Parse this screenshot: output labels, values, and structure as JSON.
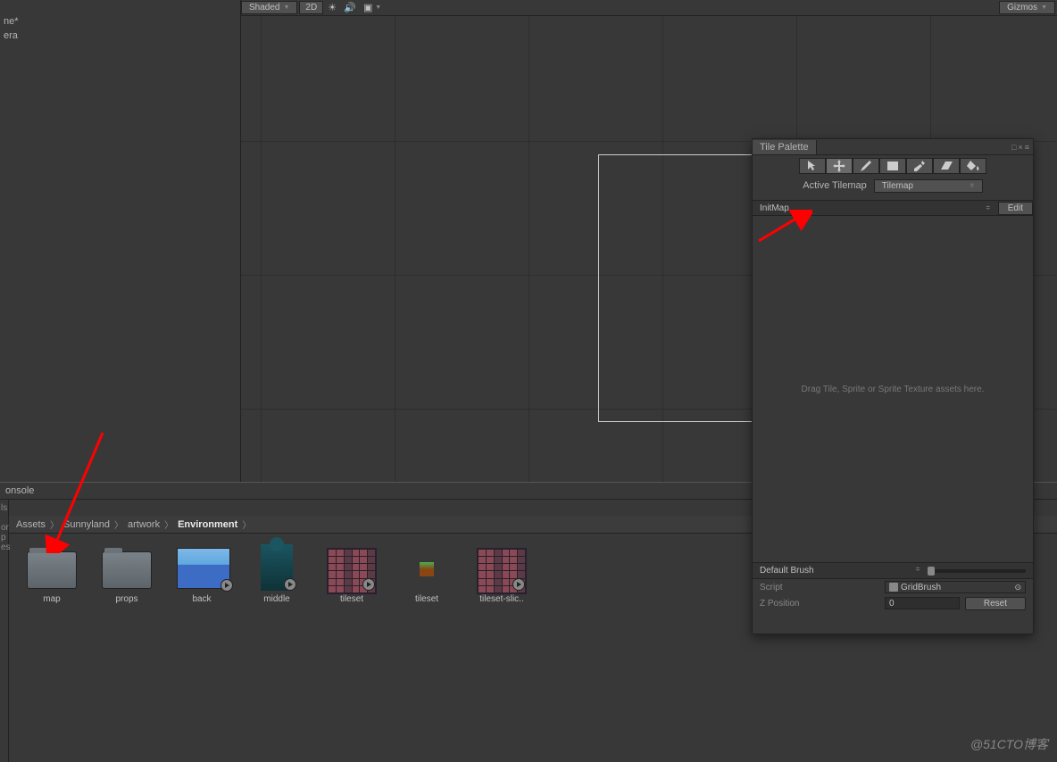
{
  "hierarchy": {
    "title_fragment": "ne*",
    "item": "era"
  },
  "scene_toolbar": {
    "shading": "Shaded",
    "mode_2d": "2D",
    "gizmos": "Gizmos"
  },
  "console": {
    "label": "onsole"
  },
  "breadcrumb": {
    "items": [
      "Assets",
      "Sunnyland",
      "artwork",
      "Environment"
    ],
    "active_index": 3
  },
  "assets": [
    {
      "type": "folder",
      "label": "map"
    },
    {
      "type": "folder",
      "label": "props"
    },
    {
      "type": "sprite",
      "label": "back",
      "play": true
    },
    {
      "type": "castle",
      "label": "middle",
      "play": true
    },
    {
      "type": "tileset",
      "label": "tileset",
      "play": true
    },
    {
      "type": "smalltile",
      "label": "tileset"
    },
    {
      "type": "tileset",
      "label": "tileset-slic..",
      "play": true
    }
  ],
  "tile_palette": {
    "title": "Tile Palette",
    "active_tilemap_label": "Active Tilemap",
    "tilemap_value": "Tilemap",
    "palette_value": "InitMap",
    "edit_label": "Edit",
    "hint": "Drag Tile, Sprite or Sprite Texture assets here.",
    "default_brush": "Default Brush",
    "script_label": "Script",
    "script_value": "GridBrush",
    "zposition_label": "Z Position",
    "zposition_value": "0",
    "reset_label": "Reset"
  },
  "project_side_labels": [
    "ls",
    "or",
    "p",
    "es"
  ],
  "watermark": "@51CTO博客"
}
